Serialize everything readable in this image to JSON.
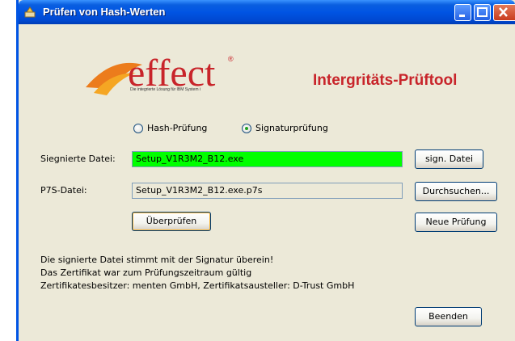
{
  "window": {
    "title": "Prüfen von Hash-Werten"
  },
  "logo": {
    "brand": "effect",
    "tagline": "Die integrierte Lösung für IBM System i"
  },
  "tool_title": "Intergritäts-Prüftool",
  "mode": {
    "options": [
      "Hash-Prüfung",
      "Signaturprüfung"
    ],
    "selected": "Signaturprüfung"
  },
  "signed_file": {
    "label": "Siegnierte Datei:",
    "value": "Setup_V1R3M2_B12.exe",
    "button": "sign. Datei"
  },
  "p7s_file": {
    "label": "P7S-Datei:",
    "value": "Setup_V1R3M2_B12.exe.p7s",
    "button": "Durchsuchen..."
  },
  "actions": {
    "verify": "Überprüfen",
    "new_check": "Neue Prüfung",
    "quit": "Beenden"
  },
  "result": {
    "line1": "Die signierte Datei stimmt mit der Signatur überein!",
    "line2": "Das Zertifikat war zum Prüfungszeitraum gültig",
    "line3": "Zertifikatesbesitzer: menten GmbH, Zertifikatsausteller: D-Trust GmbH"
  },
  "colors": {
    "title_bar": "#0054e3",
    "valid_field": "#00ff00",
    "brand_red": "#c8242a"
  }
}
